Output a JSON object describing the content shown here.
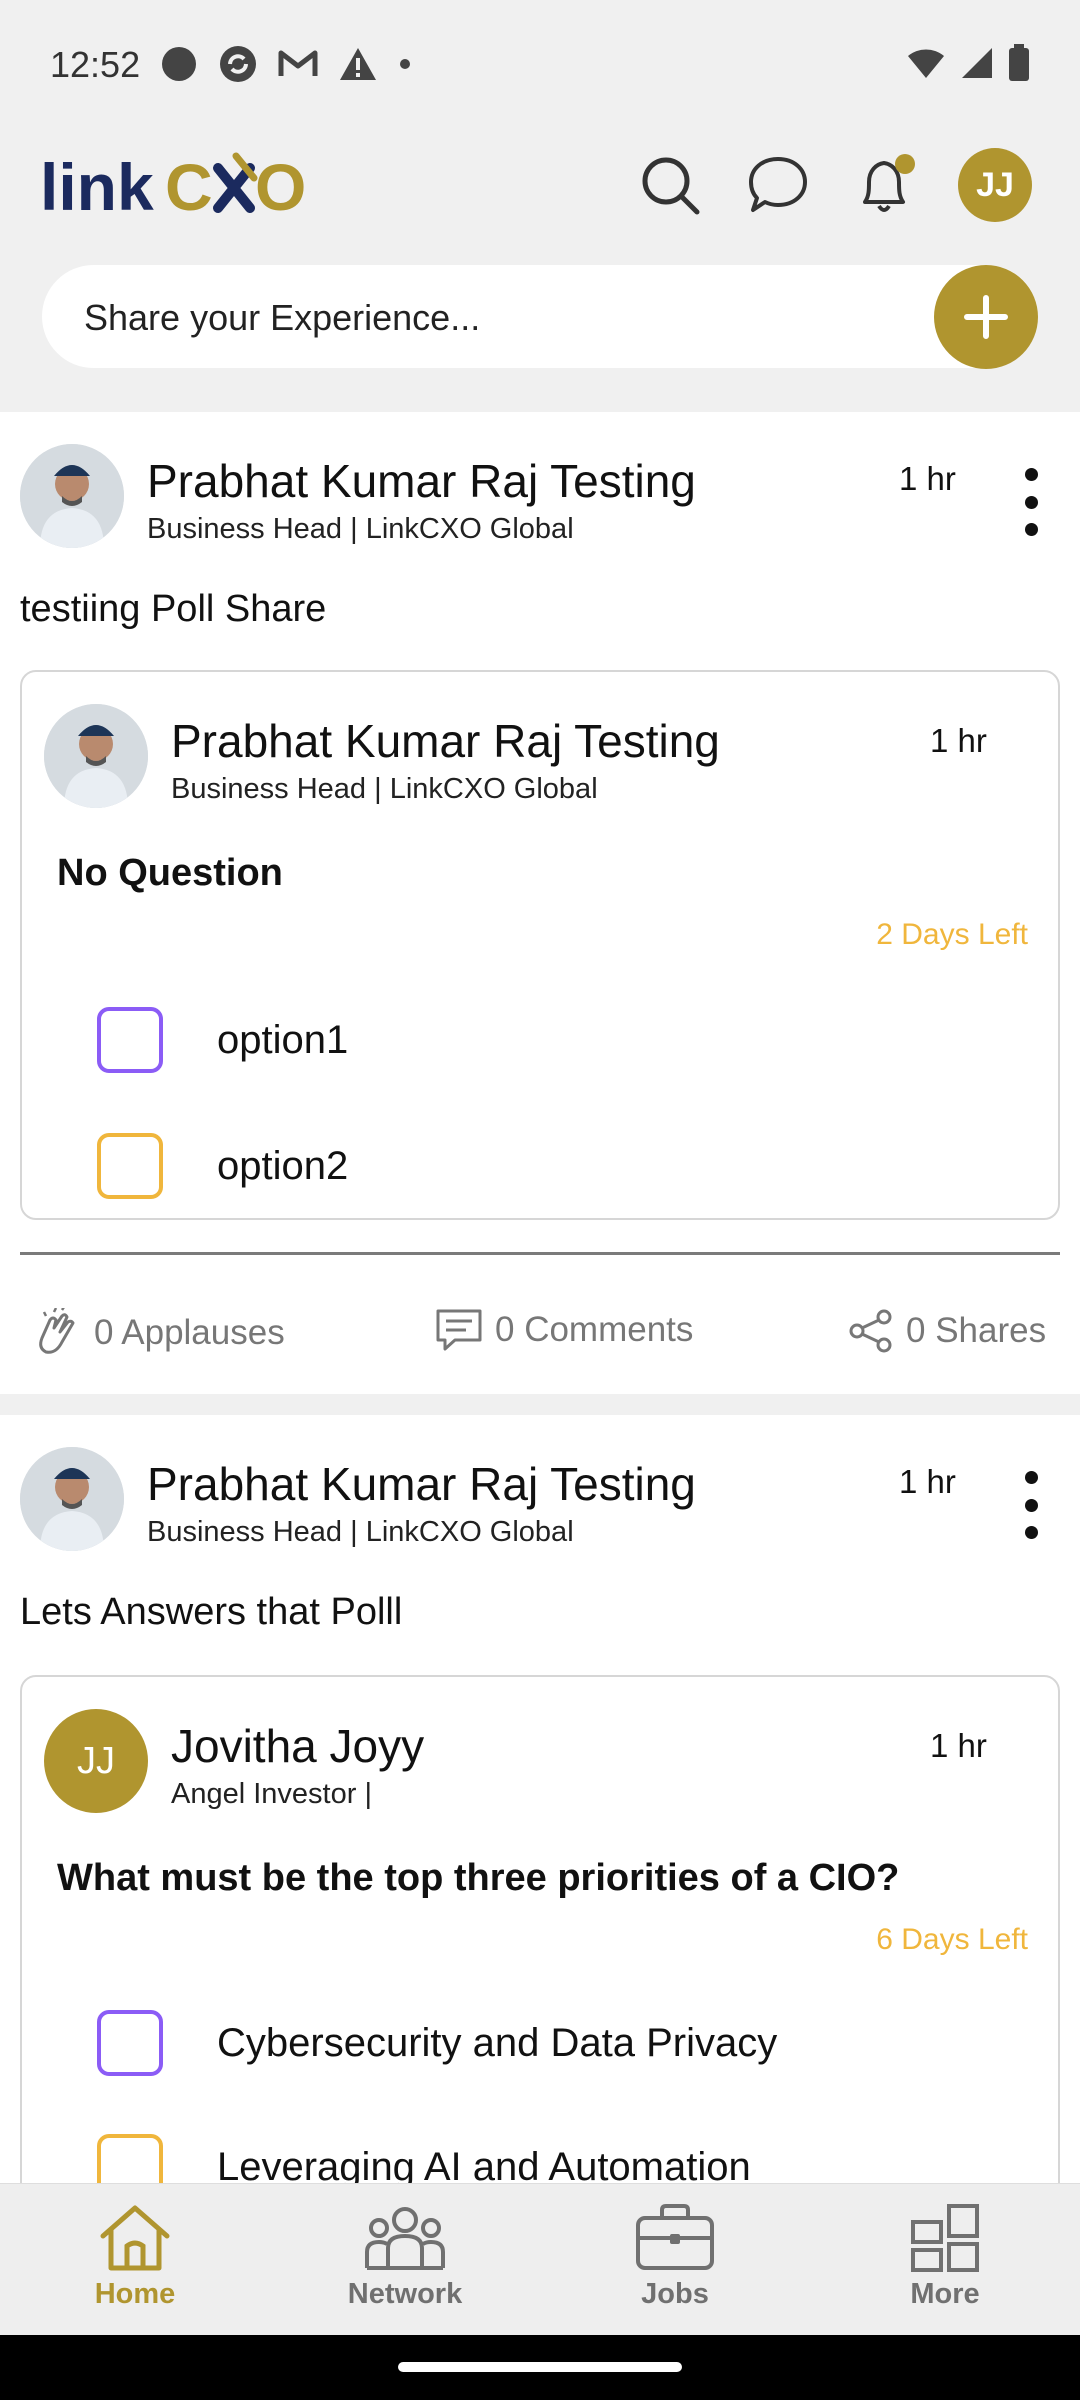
{
  "status_bar": {
    "time": "12:52"
  },
  "brand": {
    "logo_text_a": "link",
    "logo_text_b": "CXO",
    "accent": "#b0952f",
    "navy": "#1b2a5e"
  },
  "header": {
    "avatar_initials": "JJ"
  },
  "composer": {
    "placeholder": "Share your Experience..."
  },
  "posts": [
    {
      "author": "Prabhat Kumar Raj Testing",
      "subtitle": "Business Head | LinkCXO Global",
      "time": "1 hr",
      "text": "testiing Poll Share",
      "poll": {
        "author": "Prabhat Kumar Raj Testing",
        "subtitle": "Business Head | LinkCXO Global",
        "time": "1 hr",
        "question": "No Question",
        "days_left": "2 Days Left",
        "options": [
          "option1",
          "option2"
        ]
      },
      "stats": {
        "applauses": "0 Applauses",
        "comments": "0 Comments",
        "shares": "0 Shares"
      }
    },
    {
      "author": "Prabhat Kumar Raj Testing",
      "subtitle": "Business Head | LinkCXO Global",
      "time": "1 hr",
      "text": "Lets Answers that Polll",
      "poll": {
        "author": "Jovitha Joyy",
        "author_initials": "JJ",
        "subtitle": "Angel Investor |",
        "time": "1 hr",
        "question": "What must be the top three priorities of a CIO?",
        "days_left": "6 Days Left",
        "options": [
          "Cybersecurity and Data Privacy",
          "Leveraging AI and Automation"
        ]
      }
    }
  ],
  "bottom_nav": [
    {
      "label": "Home",
      "icon": "home-icon",
      "active": true
    },
    {
      "label": "Network",
      "icon": "people-icon",
      "active": false
    },
    {
      "label": "Jobs",
      "icon": "briefcase-icon",
      "active": false
    },
    {
      "label": "More",
      "icon": "grid-icon",
      "active": false
    }
  ],
  "colors": {
    "active_nav": "#b0952f",
    "inactive_nav": "#707070",
    "days_left": "#f0b63c",
    "checkbox_purple": "#8b5cf6",
    "checkbox_yellow": "#f0b63c"
  }
}
